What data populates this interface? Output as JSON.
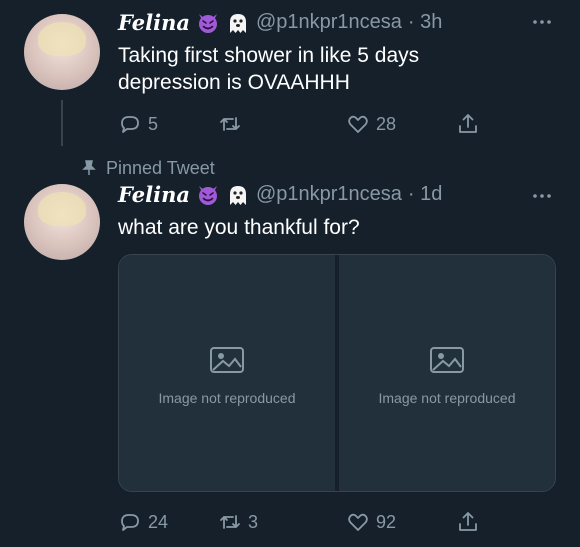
{
  "tweet1": {
    "display_name": "Felina",
    "handle": "@p1nkpr1ncesa",
    "time": "· 3h",
    "emojis": [
      "smiling-imp-emoji",
      "ghost-emoji"
    ],
    "text_line1": "Taking first shower in like 5 days",
    "text_line2": "depression is OVAAHHH",
    "replies": "5",
    "retweets": "",
    "likes": "28"
  },
  "tweet2": {
    "pinned_label": "Pinned Tweet",
    "display_name": "Felina",
    "handle": "@p1nkpr1ncesa",
    "time": "· 1d",
    "emojis": [
      "smiling-imp-emoji",
      "ghost-emoji"
    ],
    "text": "what are you thankful for?",
    "media": [
      {
        "label": "Image not reproduced"
      },
      {
        "label": "Image not reproduced"
      }
    ],
    "replies": "24",
    "retweets": "3",
    "likes": "92"
  },
  "colors": {
    "background": "#15202b",
    "secondary_text": "#8899a6",
    "divider": "#38444d",
    "emoji_purple": "#a05ad7"
  },
  "icons": [
    "more-icon",
    "reply-icon",
    "retweet-icon",
    "like-icon",
    "share-icon",
    "pin-icon"
  ]
}
